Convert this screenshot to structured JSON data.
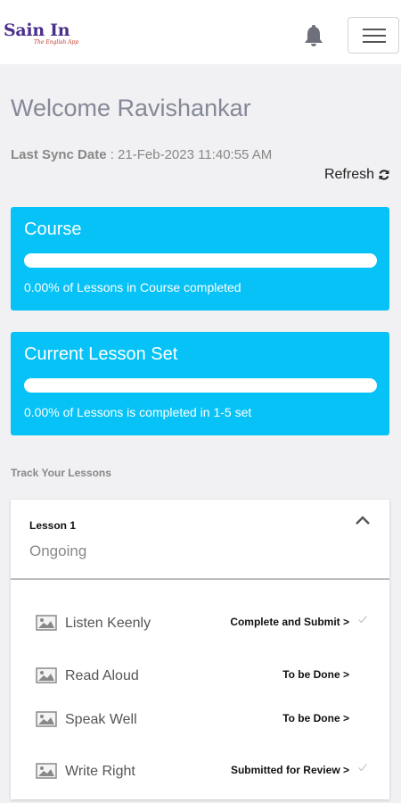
{
  "app": {
    "logo_text": "Sain In",
    "logo_tagline": "The English App"
  },
  "header": {
    "notifications_icon": "bell-icon",
    "menu_icon": "hamburger-icon"
  },
  "welcome": {
    "title": "Welcome Ravishankar",
    "sync_label": "Last Sync Date",
    "sync_value": " : 21-Feb-2023 11:40:55 AM",
    "refresh_label": "Refresh"
  },
  "cards": [
    {
      "title": "Course",
      "progress": 0.0,
      "text": "0.00% of Lessons in Course completed"
    },
    {
      "title": "Current Lesson Set",
      "progress": 0.0,
      "text": "0.00% of Lessons is completed in 1-5 set"
    }
  ],
  "track": {
    "heading": "Track Your Lessons",
    "lesson_label": "Lesson 1",
    "lesson_status": "Ongoing",
    "tasks": [
      {
        "label": "Listen Keenly",
        "status": "Complete and Submit >",
        "checked": true
      },
      {
        "label": "Read Aloud",
        "status": "To be Done >",
        "checked": false
      },
      {
        "label": "Speak Well",
        "status": "To be Done >",
        "checked": false
      },
      {
        "label": "Write Right",
        "status": "Submitted for Review >",
        "checked": true
      }
    ]
  },
  "colors": {
    "card_bg": "#06c2f6",
    "logo": "#4a2f8c",
    "page_bg": "#f1f0f2"
  }
}
